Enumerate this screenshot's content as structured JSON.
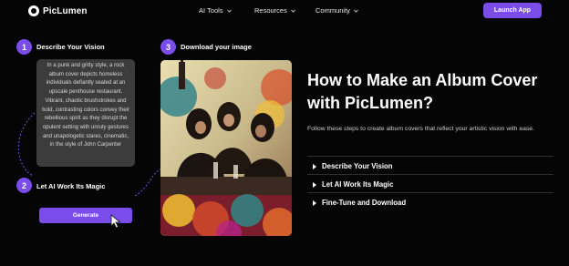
{
  "nav": {
    "brand": "PicLumen",
    "items": [
      {
        "label": "AI Tools"
      },
      {
        "label": "Resources"
      },
      {
        "label": "Community"
      }
    ],
    "launch_label": "Launch App"
  },
  "steps": [
    {
      "number": "1",
      "label": "Describe Your Vision"
    },
    {
      "number": "2",
      "label": "Let AI Work Its Magic"
    },
    {
      "number": "3",
      "label": "Download your image"
    }
  ],
  "prompt": {
    "text": "In a punk and gritty style, a rock album cover depicts homeless individuals defiantly seated at an upscale penthouse restaurant. Vibrant, chaotic brushstrokes and bold, contrasting colors convey their rebellious spirit as they disrupt the opulent setting with unruly gestures and unapologetic stares, cinematic, in the style of John Carpenter"
  },
  "generate": {
    "label": "Generate"
  },
  "main": {
    "headline": "How to Make an Album Cover with PicLumen?",
    "subtext": "Follow these steps to create album covers that reflect your artistic vision with ease.",
    "accordion": [
      {
        "label": "Describe Your Vision"
      },
      {
        "label": "Let AI Work Its Magic"
      },
      {
        "label": "Fine-Tune and Download"
      }
    ]
  },
  "colors": {
    "background": "#050505",
    "accent": "#7a4dea",
    "prompt_box": "#3c3c3c"
  },
  "icons": {
    "logo": "piclumen-logo-icon",
    "chevron": "chevron-down-icon",
    "cursor": "mouse-pointer-icon",
    "accordion": "caret-right-icon"
  }
}
